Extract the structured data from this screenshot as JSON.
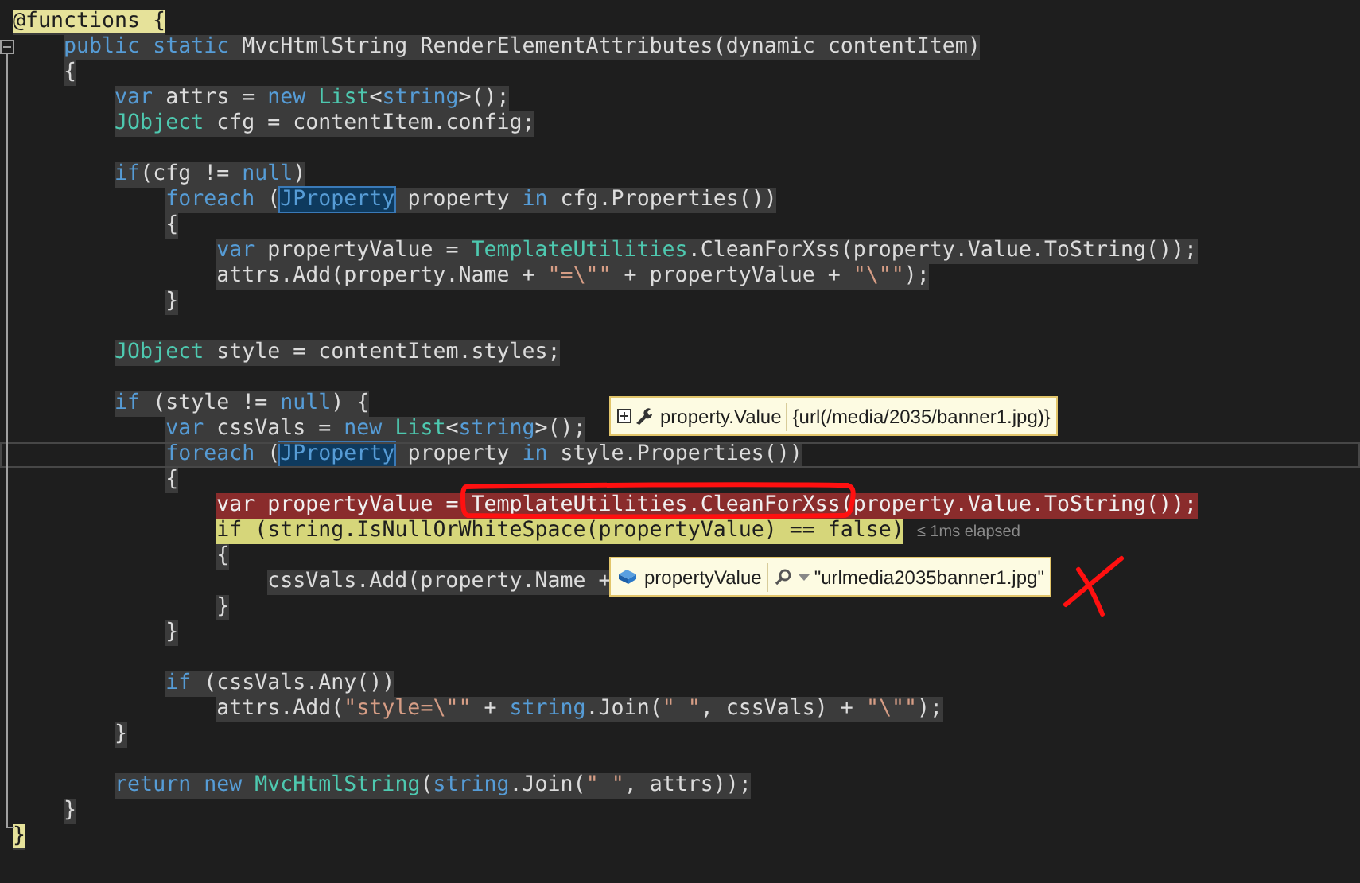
{
  "editor": {
    "lines": [
      {
        "kind": "code",
        "tokens": [
          {
            "text": "@functions {",
            "kind": "razor"
          }
        ]
      },
      {
        "kind": "code",
        "tokens": [
          {
            "text": "    public static",
            "kind": "keyword"
          },
          {
            "text": " MvcHtmlString RenderElementAttributes(dynamic contentItem)",
            "kind": "plain"
          }
        ]
      },
      {
        "kind": "code",
        "tokens": [
          {
            "text": "    {",
            "kind": "plain"
          }
        ]
      },
      {
        "kind": "code",
        "tokens": [
          {
            "text": "        var",
            "kind": "keyword"
          },
          {
            "text": " attrs = ",
            "kind": "plain"
          },
          {
            "text": "new",
            "kind": "keyword"
          },
          {
            "text": " List",
            "kind": "type"
          },
          {
            "text": "<",
            "kind": "plain"
          },
          {
            "text": "string",
            "kind": "keyword"
          },
          {
            "text": ">();",
            "kind": "plain"
          }
        ]
      },
      {
        "kind": "code",
        "tokens": [
          {
            "text": "        JObject",
            "kind": "type"
          },
          {
            "text": " cfg = contentItem.config;",
            "kind": "plain"
          }
        ]
      },
      {
        "kind": "blank"
      },
      {
        "kind": "code",
        "tokens": [
          {
            "text": "        if",
            "kind": "keyword"
          },
          {
            "text": "(cfg != ",
            "kind": "plain"
          },
          {
            "text": "null",
            "kind": "keyword"
          },
          {
            "text": ")",
            "kind": "plain"
          }
        ]
      },
      {
        "kind": "code",
        "tokens": [
          {
            "text": "            foreach",
            "kind": "keyword"
          },
          {
            "text": " (",
            "kind": "plain"
          },
          {
            "text": "JProperty",
            "kind": "reference"
          },
          {
            "text": " property ",
            "kind": "plain"
          },
          {
            "text": "in",
            "kind": "keyword"
          },
          {
            "text": " cfg.Properties())",
            "kind": "plain"
          }
        ]
      },
      {
        "kind": "code",
        "tokens": [
          {
            "text": "            {",
            "kind": "plain"
          }
        ]
      },
      {
        "kind": "code",
        "tokens": [
          {
            "text": "                var",
            "kind": "keyword"
          },
          {
            "text": " propertyValue = ",
            "kind": "plain"
          },
          {
            "text": "TemplateUtilities",
            "kind": "type"
          },
          {
            "text": ".CleanForXss(property.Value.ToString());",
            "kind": "plain"
          }
        ]
      },
      {
        "kind": "code",
        "tokens": [
          {
            "text": "                attrs.Add(property.Name + ",
            "kind": "plain"
          },
          {
            "text": "\"=\\\"\"",
            "kind": "string"
          },
          {
            "text": " + propertyValue + ",
            "kind": "plain"
          },
          {
            "text": "\"\\\"\"",
            "kind": "string"
          },
          {
            "text": ");",
            "kind": "plain"
          }
        ]
      },
      {
        "kind": "code",
        "tokens": [
          {
            "text": "            }",
            "kind": "plain"
          }
        ]
      },
      {
        "kind": "blank"
      },
      {
        "kind": "code",
        "tokens": [
          {
            "text": "        JObject",
            "kind": "type"
          },
          {
            "text": " style = contentItem.styles;",
            "kind": "plain"
          }
        ]
      },
      {
        "kind": "blank"
      },
      {
        "kind": "code",
        "tokens": [
          {
            "text": "        if",
            "kind": "keyword"
          },
          {
            "text": " (style != ",
            "kind": "plain"
          },
          {
            "text": "null",
            "kind": "keyword"
          },
          {
            "text": ") {",
            "kind": "plain"
          }
        ]
      },
      {
        "kind": "code",
        "tokens": [
          {
            "text": "            var",
            "kind": "keyword"
          },
          {
            "text": " cssVals = ",
            "kind": "plain"
          },
          {
            "text": "new",
            "kind": "keyword"
          },
          {
            "text": " List",
            "kind": "type"
          },
          {
            "text": "<",
            "kind": "plain"
          },
          {
            "text": "string",
            "kind": "keyword"
          },
          {
            "text": ">();",
            "kind": "plain"
          }
        ]
      },
      {
        "kind": "caret_line",
        "tokens": [
          {
            "text": "            foreach",
            "kind": "keyword"
          },
          {
            "text": " (",
            "kind": "plain"
          },
          {
            "text": "JProperty",
            "kind": "reference"
          },
          {
            "text": " property ",
            "kind": "plain"
          },
          {
            "text": "in",
            "kind": "keyword"
          },
          {
            "text": " style.Properties())",
            "kind": "plain"
          }
        ]
      },
      {
        "kind": "code",
        "tokens": [
          {
            "text": "            {",
            "kind": "plain"
          }
        ]
      },
      {
        "kind": "breakpoint",
        "tokens": [
          {
            "text": "                var",
            "kind": "keyword"
          },
          {
            "text": " propertyValue = ",
            "kind": "plain"
          },
          {
            "text": "TemplateUtilities",
            "kind": "type"
          },
          {
            "text": ".CleanForXss(property.Value.ToString());",
            "kind": "plain"
          }
        ]
      },
      {
        "kind": "current_statement",
        "tokens": [
          {
            "text": "                if",
            "kind": "keyword"
          },
          {
            "text": " (",
            "kind": "plain"
          },
          {
            "text": "string",
            "kind": "keyword"
          },
          {
            "text": ".IsNullOrWhiteSpace(propertyValue) == ",
            "kind": "plain"
          },
          {
            "text": "false",
            "kind": "keyword"
          },
          {
            "text": ")",
            "kind": "plain"
          }
        ],
        "perf_tip": "≤ 1ms elapsed"
      },
      {
        "kind": "code",
        "tokens": [
          {
            "text": "                {",
            "kind": "plain"
          }
        ]
      },
      {
        "kind": "code",
        "tokens": [
          {
            "text": "                    cssVals.Add(property.Name +",
            "kind": "plain"
          }
        ]
      },
      {
        "kind": "code",
        "tokens": [
          {
            "text": "                }",
            "kind": "plain"
          }
        ]
      },
      {
        "kind": "code",
        "tokens": [
          {
            "text": "            }",
            "kind": "plain"
          }
        ]
      },
      {
        "kind": "blank"
      },
      {
        "kind": "code",
        "tokens": [
          {
            "text": "            if",
            "kind": "keyword"
          },
          {
            "text": " (cssVals.Any())",
            "kind": "plain"
          }
        ]
      },
      {
        "kind": "code",
        "tokens": [
          {
            "text": "                attrs.Add(",
            "kind": "plain"
          },
          {
            "text": "\"style=\\\"\"",
            "kind": "string"
          },
          {
            "text": " + ",
            "kind": "plain"
          },
          {
            "text": "string",
            "kind": "keyword"
          },
          {
            "text": ".Join(",
            "kind": "plain"
          },
          {
            "text": "\" \"",
            "kind": "string"
          },
          {
            "text": ", cssVals) + ",
            "kind": "plain"
          },
          {
            "text": "\"\\\"\"",
            "kind": "string"
          },
          {
            "text": ");",
            "kind": "plain"
          }
        ]
      },
      {
        "kind": "code",
        "tokens": [
          {
            "text": "        }",
            "kind": "plain"
          }
        ]
      },
      {
        "kind": "blank"
      },
      {
        "kind": "code",
        "tokens": [
          {
            "text": "        return",
            "kind": "keyword"
          },
          {
            "text": " new",
            "kind": "keyword"
          },
          {
            "text": " MvcHtmlString",
            "kind": "type"
          },
          {
            "text": "(",
            "kind": "plain"
          },
          {
            "text": "string",
            "kind": "keyword"
          },
          {
            "text": ".Join(",
            "kind": "plain"
          },
          {
            "text": "\" \"",
            "kind": "string"
          },
          {
            "text": ", attrs));",
            "kind": "plain"
          }
        ]
      },
      {
        "kind": "code",
        "tokens": [
          {
            "text": "    }",
            "kind": "plain"
          }
        ]
      },
      {
        "kind": "code",
        "tokens": [
          {
            "text": "}",
            "kind": "razor"
          }
        ]
      }
    ]
  },
  "datatips": [
    {
      "kind": "object",
      "expression": "property.Value",
      "value": "{url(/media/2035/banner1.jpg)}"
    },
    {
      "kind": "string",
      "expression": "propertyValue",
      "value": "\"urlmedia2035banner1.jpg\""
    }
  ]
}
